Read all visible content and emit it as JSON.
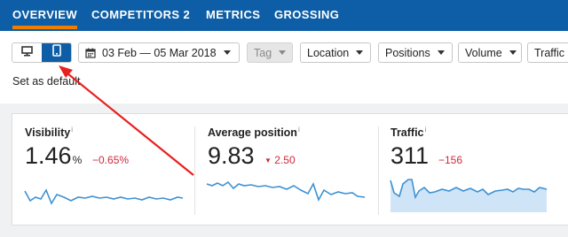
{
  "nav": {
    "tabs": [
      {
        "label": "OVERVIEW",
        "active": true
      },
      {
        "label": "COMPETITORS 2",
        "active": false
      },
      {
        "label": "METRICS",
        "active": false
      },
      {
        "label": "GROSSING",
        "active": false
      }
    ]
  },
  "toolbar": {
    "device_toggle": {
      "selected": "mobile",
      "options": [
        "desktop-icon",
        "mobile-icon"
      ]
    },
    "date_range": "03 Feb — 05 Mar 2018",
    "tag_label": "Tag",
    "location_label": "Location",
    "positions_label": "Positions",
    "volume_label": "Volume",
    "traffic_label": "Traffic",
    "set_default": "Set as default"
  },
  "metrics": [
    {
      "title": "Visibility",
      "value": "1.46",
      "unit": "%",
      "change": "−0.65%"
    },
    {
      "title": "Average position",
      "value": "9.83",
      "change": "2.50"
    },
    {
      "title": "Traffic",
      "value": "311",
      "change": "−156"
    }
  ],
  "colors": {
    "nav": "#0d5ea6",
    "active_tab_underline": "#f07c00",
    "spark_line": "#3d91d2",
    "spark_fill": "#cfe4f6",
    "negative": "#d0283b",
    "arrow": "#e8201f"
  }
}
